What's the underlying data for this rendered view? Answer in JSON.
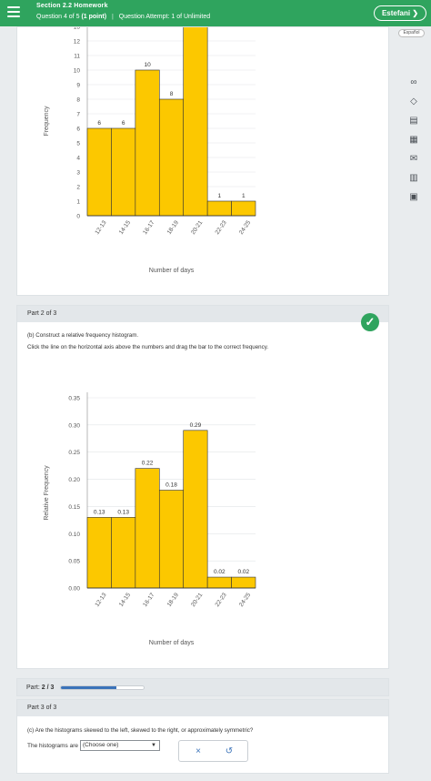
{
  "header": {
    "title": "Section 2.2 Homework",
    "question_prefix": "Question 4 of 5",
    "points": "(1 point)",
    "separator": "|",
    "attempt": "Question Attempt: 1 of Unlimited",
    "user": "Estefani",
    "language": "Español"
  },
  "side_icons": [
    "glasses-icon",
    "compass-icon",
    "notes-icon",
    "calculator-icon",
    "mail-icon",
    "bar-chart-icon",
    "book-icon"
  ],
  "colors": {
    "accent": "#2fa45e",
    "bar": "#fcc800",
    "progress": "#3b73b9"
  },
  "part1": {
    "chart_data": {
      "type": "bar",
      "categories": [
        "12-13",
        "14-15",
        "16-17",
        "18-19",
        "20-21",
        "22-23",
        "24-25"
      ],
      "values": [
        6,
        6,
        10,
        8,
        13,
        1,
        1
      ],
      "value_labels": [
        "6",
        "6",
        "10",
        "8",
        "",
        "1",
        "1"
      ],
      "ylabel": "Frequency",
      "xlabel": "Number of days",
      "yticks": [
        "0",
        "1",
        "2",
        "3",
        "4",
        "5",
        "6",
        "7",
        "8",
        "9",
        "10",
        "11",
        "12",
        "13"
      ],
      "ylim": [
        0,
        13
      ]
    }
  },
  "part2": {
    "label": "Part 2 of 3",
    "question": "(b) Construct a relative frequency histogram.",
    "instruction": "Click the line on the horizontal axis above the numbers and drag the bar to the correct frequency.",
    "check": "✓",
    "chart_data": {
      "type": "bar",
      "categories": [
        "12-13",
        "14-15",
        "16-17",
        "18-19",
        "20-21",
        "22-23",
        "24-25"
      ],
      "values": [
        0.13,
        0.13,
        0.22,
        0.18,
        0.29,
        0.02,
        0.02
      ],
      "value_labels": [
        "0.13",
        "0.13",
        "0.22",
        "0.18",
        "0.29",
        "0.02",
        "0.02"
      ],
      "ylabel": "Relative Frequency",
      "xlabel": "Number of days",
      "yticks": [
        "0.00",
        "0.05",
        "0.10",
        "0.15",
        "0.20",
        "0.25",
        "0.30",
        "0.35"
      ],
      "ylim": [
        0,
        0.35
      ]
    }
  },
  "progress": {
    "label": "Part:",
    "value": "2 / 3",
    "fraction": 0.67
  },
  "part3": {
    "label": "Part 3 of 3",
    "question": "(c) Are the histograms skewed to the left, skewed to the right, or approximately symmetric?",
    "answer_prefix": "The histograms are",
    "select_value": "(Choose one)",
    "select_arrow": "▼",
    "clear_icon": "×",
    "undo_icon": "↺"
  }
}
